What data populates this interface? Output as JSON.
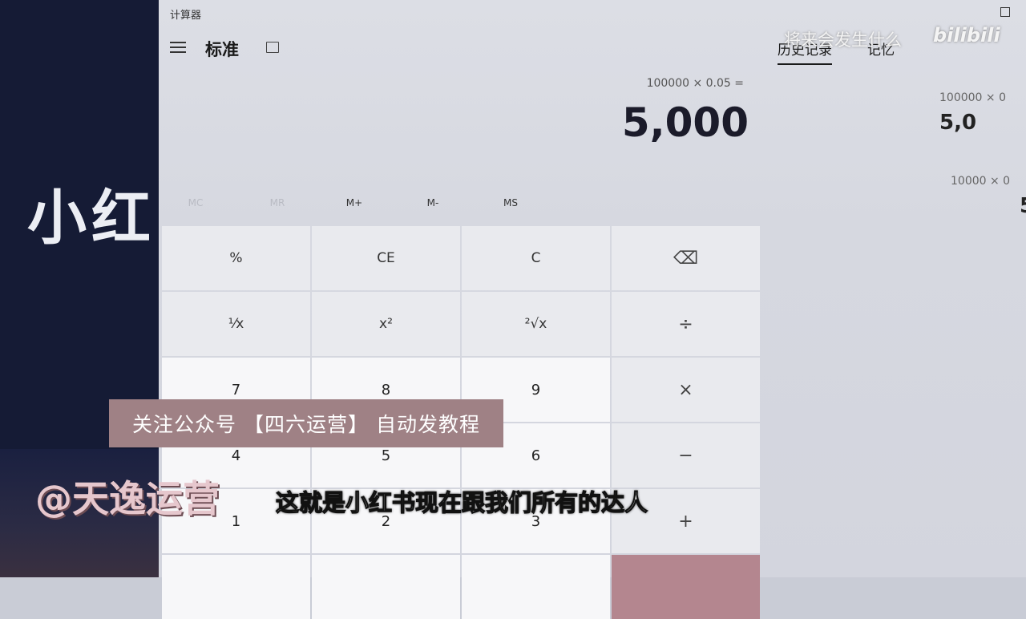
{
  "window": {
    "title": "计算器"
  },
  "header": {
    "mode": "标准"
  },
  "display": {
    "expression": "100000 × 0.05 =",
    "result": "5,000"
  },
  "memory_buttons": [
    {
      "label": "MC",
      "enabled": false
    },
    {
      "label": "MR",
      "enabled": false
    },
    {
      "label": "M+",
      "enabled": true
    },
    {
      "label": "M-",
      "enabled": true
    },
    {
      "label": "MS",
      "enabled": true
    }
  ],
  "keys": [
    [
      "%",
      "CE",
      "C",
      "⌫"
    ],
    [
      "¹⁄x",
      "x²",
      "²√x",
      "÷"
    ],
    [
      "7",
      "8",
      "9",
      "×"
    ],
    [
      "4",
      "5",
      "6",
      "−"
    ],
    [
      "1",
      "2",
      "3",
      "+"
    ]
  ],
  "side_tabs": {
    "history": "历史记录",
    "memory": "记忆"
  },
  "history": [
    {
      "expression": "100000  ×  0",
      "value": "5,0"
    },
    {
      "expression": "10000  ×  0",
      "value": "5"
    }
  ],
  "left_panel": {
    "big_text": "小红"
  },
  "overlays": {
    "watermark": "将来会发生什么",
    "bilibili": "bilibili",
    "promo": "关注公众号 【四六运营】 自动发教程",
    "author": "@天逸运营",
    "subtitle": "这就是小红书现在跟我们所有的达人"
  },
  "colors": {
    "equals_accent": "#b4868f",
    "promo_bg": "#9f8185",
    "left_panel_bg": "#151b35"
  }
}
